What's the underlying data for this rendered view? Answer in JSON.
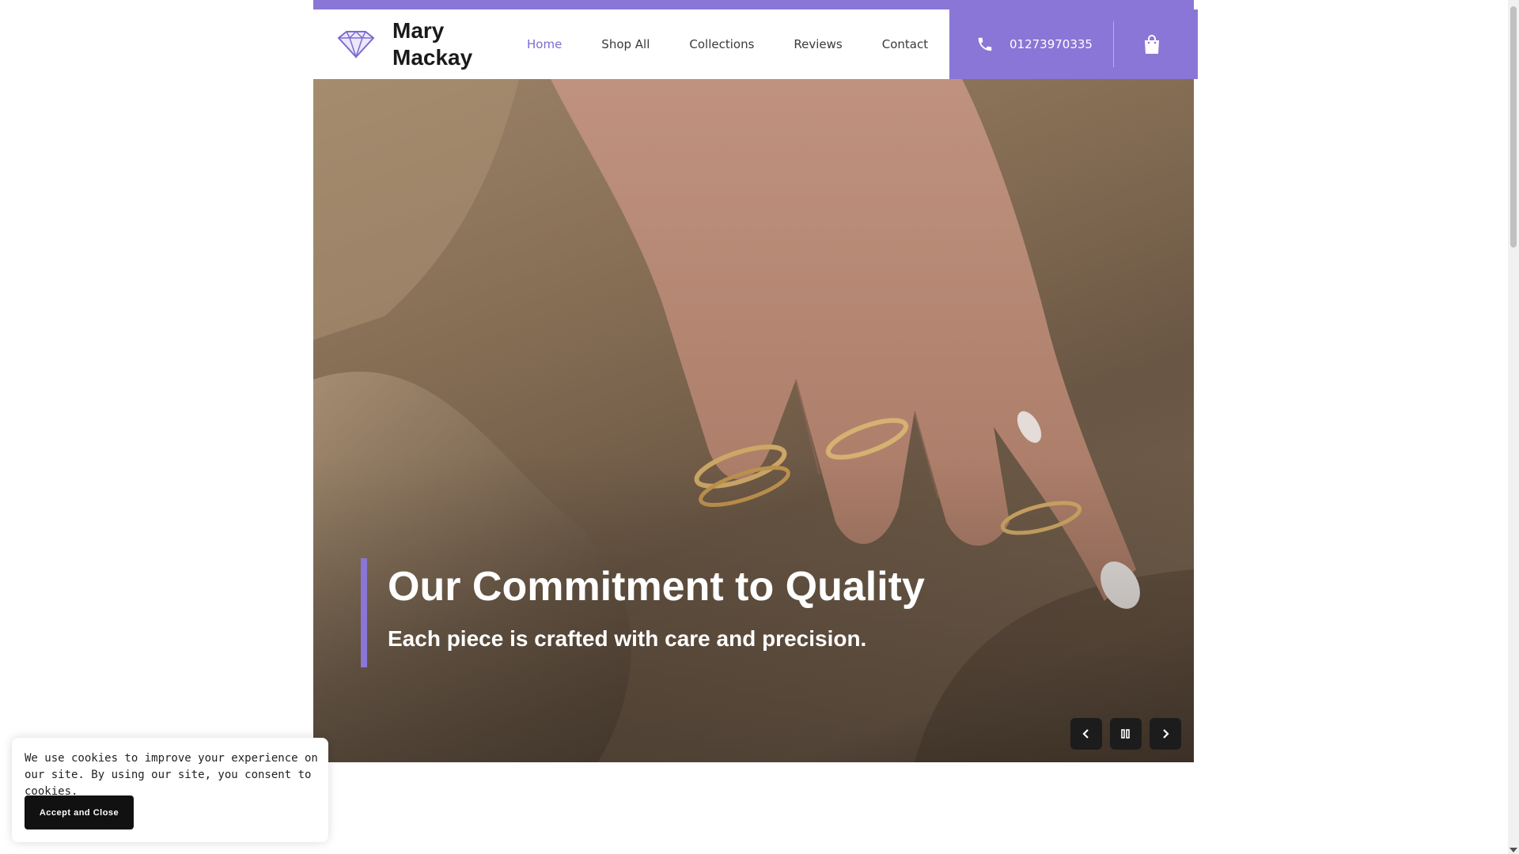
{
  "brand": {
    "name": "Mary Mackay",
    "logo_icon": "diamond-icon",
    "accent_color": "#8a76d6"
  },
  "nav": {
    "items": [
      {
        "label": "Home",
        "active": true
      },
      {
        "label": "Shop All",
        "active": false
      },
      {
        "label": "Collections",
        "active": false
      },
      {
        "label": "Reviews",
        "active": false
      },
      {
        "label": "Contact",
        "active": false
      }
    ]
  },
  "contact": {
    "phone": "01273970335",
    "phone_icon": "phone-icon",
    "cart_icon": "shopping-bag-icon"
  },
  "hero": {
    "title": "Our Commitment to Quality",
    "subtitle": "Each piece is crafted with care and precision.",
    "controls": {
      "prev_icon": "chevron-left-icon",
      "pause_icon": "pause-icon",
      "next_icon": "chevron-right-icon"
    }
  },
  "cookie": {
    "message": "We use cookies to improve your experience on our site. By using our site, you consent to cookies.",
    "accept_label": "Accept and Close"
  }
}
